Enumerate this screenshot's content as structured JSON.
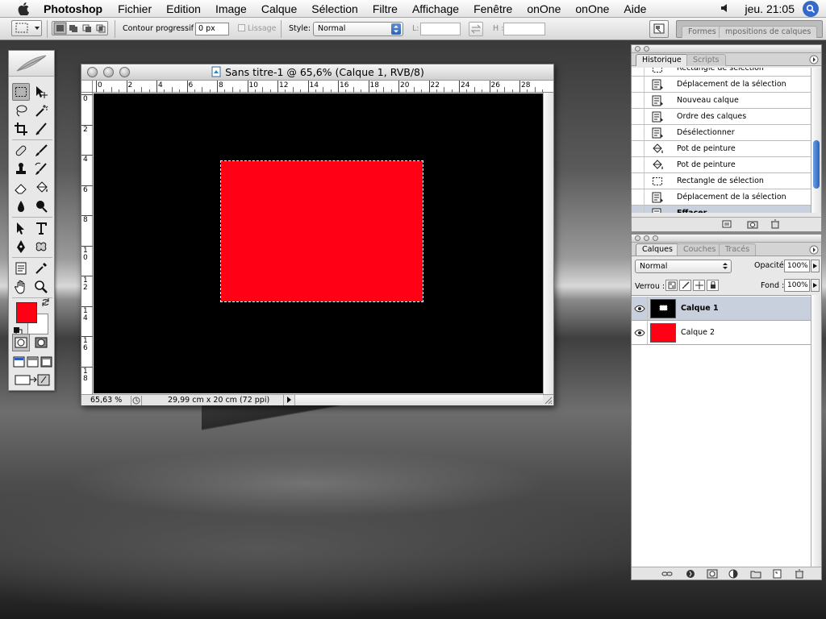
{
  "menubar": {
    "apple_icon": "apple-icon",
    "app_name": "Photoshop",
    "items": [
      "Fichier",
      "Edition",
      "Image",
      "Calque",
      "Sélection",
      "Filtre",
      "Affichage",
      "Fenêtre",
      "onOne",
      "onOne",
      "Aide"
    ],
    "clock": "jeu. 21:05",
    "volume_icon": "speaker-icon",
    "search_icon": "spotlight-icon"
  },
  "options": {
    "feather_label": "Contour progressif :",
    "feather_value": "0 px",
    "antialias_label": "Lissage",
    "style_label": "Style:",
    "style_value": "Normal",
    "width_label": "L:",
    "width_value": "",
    "height_label": "H :",
    "height_value": "",
    "palette_tabs": [
      "Formes",
      "mpositions de calques"
    ]
  },
  "document": {
    "title": "Sans titre-1 @ 65,6% (Calque 1, RVB/8)",
    "ruler_top": [
      "0",
      "2",
      "4",
      "6",
      "8",
      "10",
      "12",
      "14",
      "16",
      "18",
      "20",
      "22",
      "24",
      "26",
      "28"
    ],
    "ruler_left": [
      "0",
      "2",
      "4",
      "6",
      "8",
      "1\n0",
      "1\n2",
      "1\n4",
      "1\n6",
      "1\n8"
    ],
    "zoom": "65,63 %",
    "doc_info": "29,99 cm x 20 cm (72 ppi)",
    "canvas_color": "#000000",
    "selection_fill": "#ff0015"
  },
  "history": {
    "tabs": [
      "Historique",
      "Scripts"
    ],
    "items": [
      {
        "label": "Rectangle de sélection",
        "icon": "marquee-icon"
      },
      {
        "label": "Déplacement de la sélection",
        "icon": "document-icon"
      },
      {
        "label": "Nouveau calque",
        "icon": "document-icon"
      },
      {
        "label": "Ordre des calques",
        "icon": "document-icon"
      },
      {
        "label": "Désélectionner",
        "icon": "document-icon"
      },
      {
        "label": "Pot de peinture",
        "icon": "paint-bucket-icon"
      },
      {
        "label": "Pot de peinture",
        "icon": "paint-bucket-icon"
      },
      {
        "label": "Rectangle de sélection",
        "icon": "marquee-icon"
      },
      {
        "label": "Déplacement de la sélection",
        "icon": "document-icon"
      },
      {
        "label": "Effacer",
        "icon": "document-icon"
      }
    ]
  },
  "layers": {
    "tabs": [
      "Calques",
      "Couches",
      "Tracés"
    ],
    "blend_mode": "Normal",
    "opacity_label": "Opacité:",
    "opacity_value": "100%",
    "lock_label": "Verrou :",
    "fill_label": "Fond :",
    "fill_value": "100%",
    "items": [
      {
        "name": "Calque 1",
        "thumb_color": "#000000",
        "active": true
      },
      {
        "name": "Calque 2",
        "thumb_color": "#ff0015",
        "active": false
      }
    ]
  },
  "colors": {
    "foreground": "#ff0015",
    "background": "#ffffff",
    "accent": "#3569c9"
  }
}
